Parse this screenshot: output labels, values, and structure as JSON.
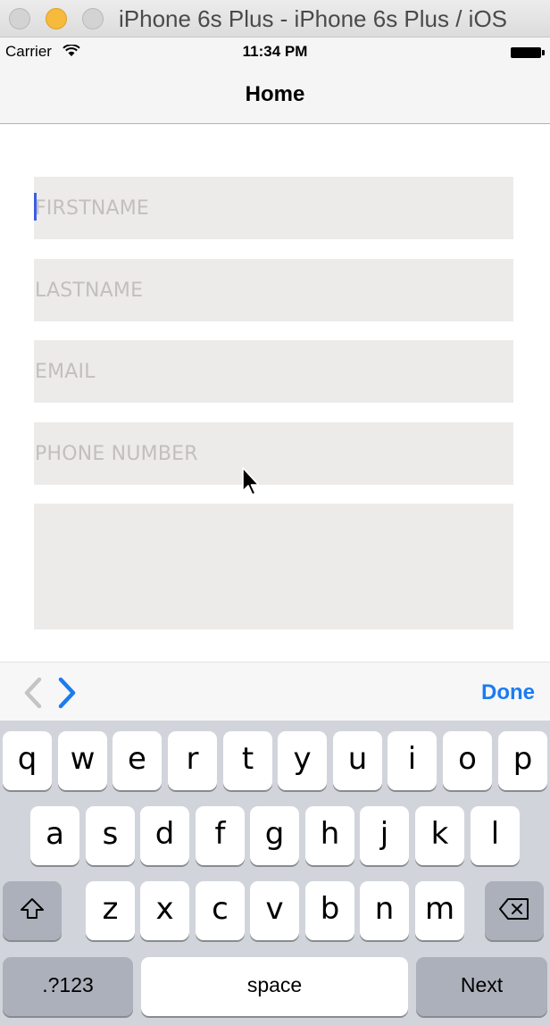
{
  "window": {
    "title": "iPhone 6s Plus - iPhone 6s Plus / iOS"
  },
  "status_bar": {
    "carrier": "Carrier",
    "time": "11:34 PM"
  },
  "nav": {
    "title": "Home"
  },
  "form": {
    "firstname_placeholder": "FIRSTNAME",
    "lastname_placeholder": "LASTNAME",
    "email_placeholder": "EMAIL",
    "phone_placeholder": "PHONE NUMBER",
    "message_placeholder": ""
  },
  "accessory": {
    "done_label": "Done"
  },
  "keyboard": {
    "row1": [
      "q",
      "w",
      "e",
      "r",
      "t",
      "y",
      "u",
      "i",
      "o",
      "p"
    ],
    "row2": [
      "a",
      "s",
      "d",
      "f",
      "g",
      "h",
      "j",
      "k",
      "l"
    ],
    "row3": [
      "z",
      "x",
      "c",
      "v",
      "b",
      "n",
      "m"
    ],
    "numbers_label": ".?123",
    "space_label": "space",
    "next_label": "Next"
  },
  "colors": {
    "accent": "#1b7cf0",
    "field_bg": "#edebe9",
    "keyboard_bg": "#d1d5db"
  }
}
